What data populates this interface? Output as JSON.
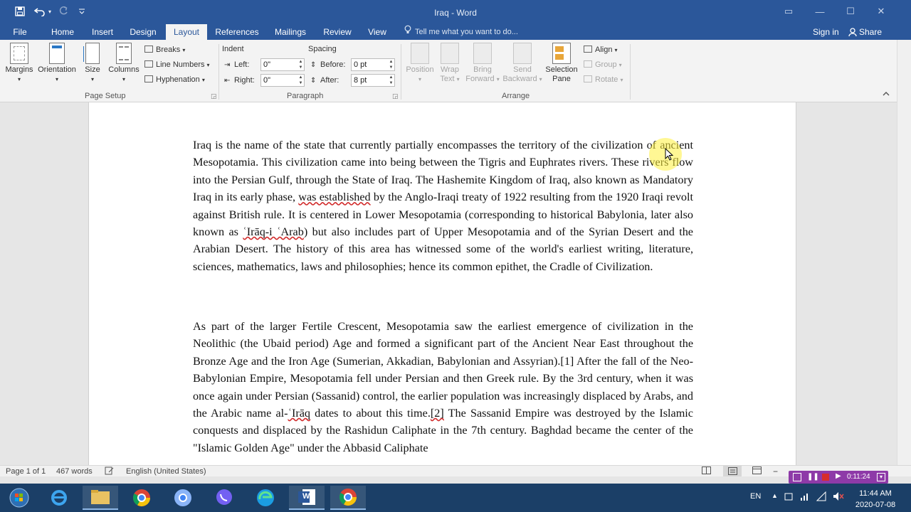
{
  "window": {
    "title": "Iraq - Word",
    "minimize": "—",
    "maximize": "☐",
    "close": "✕",
    "restore_ribbon": "▭"
  },
  "quick_access": {
    "save": "💾",
    "undo": "↶",
    "undo_dd": "▾",
    "redo": "↷",
    "customize": "⌄"
  },
  "tabs": [
    {
      "label": "File"
    },
    {
      "label": "Home"
    },
    {
      "label": "Insert"
    },
    {
      "label": "Design"
    },
    {
      "label": "Layout"
    },
    {
      "label": "References"
    },
    {
      "label": "Mailings"
    },
    {
      "label": "Review"
    },
    {
      "label": "View"
    }
  ],
  "active_tab": "Layout",
  "tell_me": "Tell me what you want to do...",
  "sign_in": "Sign in",
  "share": "Share",
  "ribbon": {
    "page_setup": {
      "label": "Page Setup",
      "margins": "Margins",
      "orientation": "Orientation",
      "size": "Size",
      "columns": "Columns",
      "breaks": "Breaks",
      "line_numbers": "Line Numbers",
      "hyphenation": "Hyphenation"
    },
    "paragraph": {
      "label": "Paragraph",
      "indent": "Indent",
      "spacing": "Spacing",
      "left_label": "Left:",
      "left_value": "0\"",
      "right_label": "Right:",
      "right_value": "0\"",
      "before_label": "Before:",
      "before_value": "0 pt",
      "after_label": "After:",
      "after_value": "8 pt"
    },
    "arrange": {
      "label": "Arrange",
      "position": "Position",
      "wrap_text_1": "Wrap",
      "wrap_text_2": "Text",
      "bring_forward_1": "Bring",
      "bring_forward_2": "Forward",
      "send_backward_1": "Send",
      "send_backward_2": "Backward",
      "selection_pane_1": "Selection",
      "selection_pane_2": "Pane",
      "align": "Align",
      "group": "Group",
      "rotate": "Rotate"
    }
  },
  "document": {
    "p1": {
      "a": "Iraq is the name of the state that currently partially encompasses the territory of the civilization of ancient Mesopotamia. This civilization came into being between the Tigris and Euphrates rivers. These rivers flow into the Persian Gulf, through the State of Iraq. The Hashemite Kingdom of Iraq, also known as Mandatory Iraq in its early phase, ",
      "sq1": "was established",
      "b": " by the Anglo-Iraqi treaty of 1922 resulting from the 1920 Iraqi revolt against British rule. It is centered in Lower Mesopotamia (corresponding to historical Babylonia, later also known as ",
      "sq2": "ʿIrāq-i ʿArab",
      "c": ") but also includes part of Upper Mesopotamia and of the Syrian Desert and the Arabian Desert. The history of this area has witnessed some of the world's earliest writing, literature, sciences, mathematics, laws and philosophies; hence its common epithet, the Cradle of Civilization."
    },
    "p2": {
      "a": "As part of the larger Fertile Crescent, Mesopotamia saw the earliest emergence of civilization in the Neolithic (the Ubaid period) Age and formed a significant part of the Ancient Near East throughout the Bronze Age and the Iron Age (Sumerian, Akkadian, Babylonian and Assyrian).[1] After the fall of the Neo-Babylonian Empire, Mesopotamia fell under Persian and then Greek rule. By the 3rd century, when it was once again under Persian (Sassanid) control, the earlier population was increasingly displaced by Arabs, and the Arabic name al-",
      "sq1": "ʿIrāq",
      "b": " dates to about this time.",
      "sq2": "[2]",
      "c": " The Sassanid Empire was destroyed by the Islamic conquests and displaced by the Rashidun Caliphate in the 7th century. Baghdad became the center of the \"Islamic Golden Age\" under the Abbasid Caliphate"
    }
  },
  "status": {
    "page": "Page 1 of 1",
    "words": "467 words",
    "language": "English (United States)",
    "zoom_minus": "−",
    "zoom_plus": "+"
  },
  "recorder": {
    "time": "0:11:24"
  },
  "taskbar": {
    "language": "EN",
    "time": "11:44 AM",
    "date": "2020-07-08",
    "word_letter": "W"
  }
}
